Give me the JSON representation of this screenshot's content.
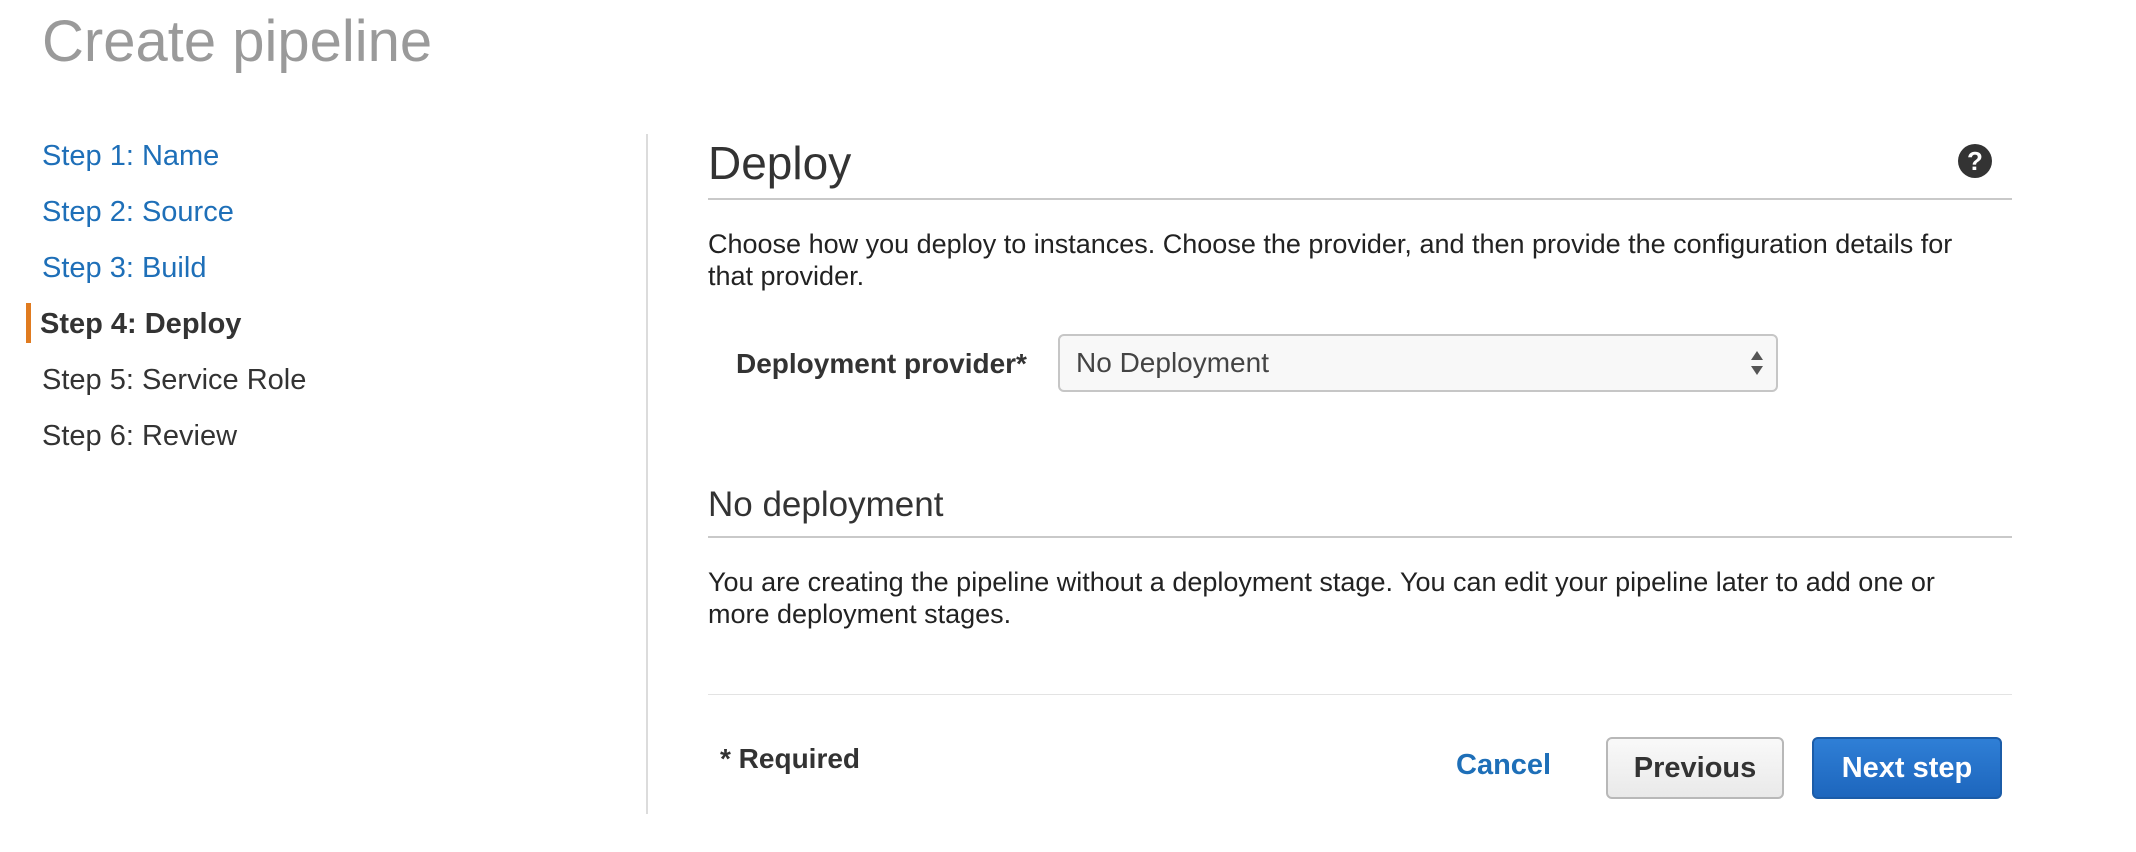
{
  "page": {
    "title": "Create pipeline"
  },
  "steps": [
    {
      "label": "Step 1: Name",
      "state": "completed"
    },
    {
      "label": "Step 2: Source",
      "state": "completed"
    },
    {
      "label": "Step 3: Build",
      "state": "completed"
    },
    {
      "label": "Step 4: Deploy",
      "state": "active"
    },
    {
      "label": "Step 5: Service Role",
      "state": "pending"
    },
    {
      "label": "Step 6: Review",
      "state": "pending"
    }
  ],
  "deploy": {
    "title": "Deploy",
    "help_icon": "help-circle-icon",
    "description": "Choose how you deploy to instances. Choose the provider, and then provide the configuration details for that provider.",
    "provider_label": "Deployment provider*",
    "provider_value": "No Deployment",
    "select_icon": "up-down-arrows-icon"
  },
  "no_deployment": {
    "title": "No deployment",
    "description": "You are creating the pipeline without a deployment stage. You can edit your pipeline later to add one or more deployment stages."
  },
  "footer": {
    "required_note": "* Required",
    "cancel_label": "Cancel",
    "previous_label": "Previous",
    "next_label": "Next step"
  },
  "colors": {
    "link": "#1e6fb8",
    "active_step_marker": "#e07b20",
    "primary_button": "#1d66bd",
    "page_title": "#9a9a9a"
  }
}
